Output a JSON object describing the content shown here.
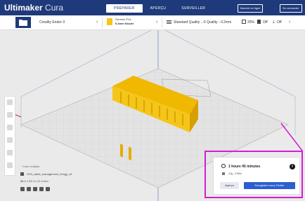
{
  "app": {
    "brand": "Ultimaker",
    "product": "Cura"
  },
  "stage_tabs": [
    {
      "label": "PRÉPARER",
      "active": true
    },
    {
      "label": "APERÇU",
      "active": false
    },
    {
      "label": "SURVEILLER",
      "active": false
    }
  ],
  "header_buttons": {
    "marketplace": "Marché en ligne",
    "signin": "Se connecter"
  },
  "toolbar": {
    "printer": "Creality Ender-3",
    "material_line1": "Generic PLA",
    "material_line2": "0.4mm Nozzle",
    "profile": "Standard Quality ...0 Quality - 0.2mm",
    "infill": "20%",
    "support": "Off",
    "adhesion": "Off"
  },
  "object_info": {
    "list_title": "Liste d'objets",
    "filename": "CE3_cable_management_thingy_v5",
    "dimensions": "88.2 x 25.4 x 21.0 mm"
  },
  "print_panel": {
    "time": "1 heure 45 minutes",
    "material": "12g · 3.99m",
    "preview_button": "Aperçu",
    "save_button": "Enregistrer sous Fichier"
  },
  "colors": {
    "header": "#1f3a7a",
    "accent": "#2b5fd0",
    "model": "#f5c518",
    "highlight": "#d21fd2"
  }
}
